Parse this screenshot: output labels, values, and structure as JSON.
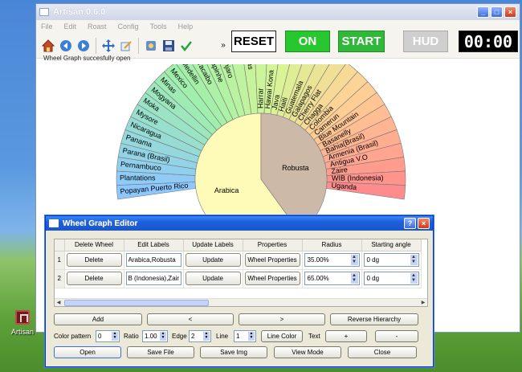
{
  "desktop": {
    "icon_label": "Artisan"
  },
  "main_window": {
    "title": "Artisan 0.6.0",
    "menu": [
      "File",
      "Edit",
      "Roast",
      "Config",
      "Tools",
      "Help"
    ],
    "overflow_label": "»",
    "buttons": {
      "reset": "RESET",
      "on": "ON",
      "start": "START",
      "hud": "HUD"
    },
    "timer": "00:00",
    "status_message": "Wheel Graph succesfully open",
    "colors": {
      "on_button": "#29c72f",
      "start_button": "#2fb83a",
      "hud_button": "#cfcfcf"
    }
  },
  "wheel": {
    "inner": [
      {
        "label": "Arabica",
        "start": 90,
        "end": 306,
        "color": "#fefab8"
      },
      {
        "label": "Robusta",
        "start": 306,
        "end": 450,
        "color": "#cdb9a8"
      }
    ],
    "outer_labels": [
      "Popayan Puerto Rico",
      "Plantations",
      "Pernambuco",
      "Parana (Brasil)",
      "Panama",
      "Nicaragua",
      "Mysore",
      "Moka",
      "Mogyana",
      "Minas",
      "Mexico",
      "Medellin",
      "Maracaibo",
      "Marrapinhe",
      "Kilimanjaro",
      "Kenya",
      "Honduras",
      "Harrar",
      "Hawai Kona",
      "Java",
      "Haiti",
      "Guatemala",
      "Galapagos",
      "Cherry Flat",
      "Chagga",
      "Colombia",
      "Camerun",
      "Blue Mountain",
      "Basanelly",
      "Bahia(Brasil)",
      "Armenia (Brasil)",
      "Antigua V.O",
      "Zaire",
      "WIB (Indonesia)",
      "Uganda"
    ]
  },
  "dialog": {
    "title": "Wheel Graph Editor",
    "columns": [
      "Delete Wheel",
      "Edit Labels",
      "Update Labels",
      "Properties",
      "Radius",
      "Starting angle"
    ],
    "rows": [
      {
        "num": "1",
        "delete": "Delete",
        "labels": "Arabica,Robusta",
        "update": "Update",
        "props": "Wheel Properties",
        "radius": "35.00%",
        "angle": "0 dg"
      },
      {
        "num": "2",
        "delete": "Delete",
        "labels": "B (Indonesia),Zaire",
        "update": "Update",
        "props": "Wheel Properties",
        "radius": "65.00%",
        "angle": "0 dg"
      }
    ],
    "nav": {
      "add": "Add",
      "prev": "<",
      "next": ">",
      "reverse": "Reverse Hierarchy"
    },
    "controls": {
      "color_pattern_label": "Color pattern",
      "color_pattern": "0",
      "ratio_label": "Ratio",
      "ratio": "1.00",
      "edge_label": "Edge",
      "edge": "2",
      "line_label": "Line",
      "line": "1",
      "line_color": "Line Color",
      "text_label": "Text",
      "plus": "+",
      "minus": "-"
    },
    "footer": {
      "open": "Open",
      "save_file": "Save File",
      "save_img": "Save Img",
      "view_mode": "View Mode",
      "close": "Close"
    }
  }
}
